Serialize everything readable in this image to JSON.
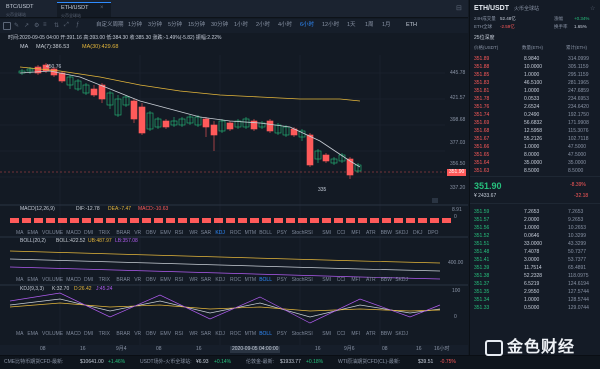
{
  "tabs": [
    {
      "symbol": "BTC/USDT",
      "exchange": "火币全球站"
    },
    {
      "symbol": "ETH/USDT",
      "exchange": "火币全球站"
    }
  ],
  "toolbar": {
    "items": [
      "自定义周期",
      "1分钟",
      "3分钟",
      "5分钟",
      "15分钟",
      "30分钟",
      "1小时",
      "2小时",
      "4小时",
      "6小时",
      "12小时",
      "1天",
      "1周",
      "1月",
      "ETH"
    ],
    "active": "4小时"
  },
  "info": {
    "line1": "时间:2020-09-05 04:00  开:391.16  高:393.00  低:384.30  收:385.30  涨跌:-1.49%(-5.82)  振幅:2.22%",
    "ma_label": "MA",
    "ma7": "MA(7):386.53",
    "ma30": "MA(30):429.68"
  },
  "chart": {
    "y_labels": [
      "445.78",
      "421.57",
      "398.68",
      "377.03",
      "356.50",
      "337.20"
    ],
    "price_tag": "351.90",
    "high_label": "450.76",
    "low_label": "335",
    "macd_label": "MACD(12,26,9)",
    "macd_dif": "DIF:-12.78",
    "macd_dea": "DEA:-7.47",
    "macd_val": "MACD:-10.63",
    "macd_tag": "8.91",
    "macd_tag2": "0",
    "boll_label": "BOLL(20,2)",
    "boll_up": "BOLL:422.52",
    "boll_ub": "UB:487.97",
    "boll_lb": "LB:357.08",
    "boll_tag": "400.00",
    "kdj_label": "KDJ(9,3,3)",
    "kdj_k": "K:32.70",
    "kdj_d": "D:26.42",
    "kdj_j": "J:45.24",
    "kdj_tag": "100",
    "kdj_tag2": "0",
    "indicators": [
      "MA",
      "EMA",
      "VOLUME",
      "MACD",
      "DMI",
      "TRIX",
      "BRAR",
      "VR",
      "OBV",
      "EMV",
      "RSI",
      "WR",
      "SAR",
      "KDJ",
      "ROC",
      "MTM",
      "BOLL",
      "PSY",
      "StochRSI",
      "SMI",
      "CCI",
      "MFI",
      "ATR",
      "BBW",
      "SKDJ",
      "DKJ",
      "DPO"
    ],
    "indicators2": [
      "MA",
      "EMA",
      "VOLUME",
      "MACD",
      "DMI",
      "TRIX",
      "BRAR",
      "VR",
      "OBV",
      "EMV",
      "RSI",
      "WR",
      "SAR",
      "KDJ",
      "ROC",
      "MTM",
      "BOLL",
      "PSY",
      "StochRSI",
      "SMI",
      "CCI",
      "MFI",
      "ATR",
      "BBW",
      "SKDJ"
    ],
    "indicators3": [
      "MA",
      "EMA",
      "VOLUME",
      "MACD",
      "DMI",
      "TRIX",
      "BRAR",
      "VR",
      "OBV",
      "EMV",
      "RSI",
      "WR",
      "SAR",
      "KDJ",
      "ROC",
      "MTM",
      "BOLL",
      "PSY",
      "StochRSI",
      "SMI",
      "CCI",
      "MFI",
      "ATR",
      "BBW",
      "SKDJ"
    ]
  },
  "timebar": {
    "labels": [
      "08",
      "16",
      "9月4",
      "08",
      "16",
      "2020-09-05 04:00:00",
      "16",
      "9月6",
      "08",
      "16"
    ],
    "right": "16小时"
  },
  "right": {
    "title": "ETH/USDT",
    "exchange": "火币全球站",
    "sub1_label": "24H成交量",
    "sub1_val": "52.48亿",
    "sub2_label": "涨幅",
    "sub2_val": "+0.34%",
    "sub3_label": "ETH全球",
    "sub3_val": "-2.59亿",
    "sub4_label": "换手率",
    "sub4_val": "1.65%",
    "depth_label": "25位深度",
    "cols": [
      "价格(USDT)",
      "数量(ETH)",
      "累计(ETH)"
    ],
    "asks": [
      [
        "351.89",
        "8.9840",
        "314.0999"
      ],
      [
        "351.88",
        "10.0000",
        "305.1159"
      ],
      [
        "351.85",
        "1.0000",
        "295.1159"
      ],
      [
        "351.83",
        "46.5100",
        "281.1965"
      ],
      [
        "351.81",
        "1.0000",
        "247.6859"
      ],
      [
        "351.78",
        "0.0533",
        "234.6953"
      ],
      [
        "351.76",
        "2.6524",
        "234.6420"
      ],
      [
        "351.74",
        "0.2490",
        "192.1750"
      ],
      [
        "351.69",
        "56.6832",
        "171.9908"
      ],
      [
        "351.68",
        "12.5958",
        "115.3076"
      ],
      [
        "351.67",
        "55.2126",
        "102.7118"
      ],
      [
        "351.66",
        "1.0000",
        "47.5000"
      ],
      [
        "351.65",
        "8.0000",
        "47.5000"
      ],
      [
        "351.64",
        "35.0000",
        "35.0000"
      ],
      [
        "351.63",
        "8.5000",
        "8.5000"
      ]
    ],
    "last_price": "351.90",
    "last_change": "-8.39%",
    "last_sub": "¥ 2433.67",
    "last_sub2": "-32.18",
    "bids": [
      [
        "351.59",
        "7.2653",
        "7.2653"
      ],
      [
        "351.57",
        "2.0000",
        "9.2653"
      ],
      [
        "351.56",
        "1.0000",
        "10.2653"
      ],
      [
        "351.52",
        "0.0646",
        "10.3299"
      ],
      [
        "351.51",
        "33.0000",
        "43.3299"
      ],
      [
        "351.48",
        "7.4078",
        "50.7377"
      ],
      [
        "351.41",
        "3.0000",
        "53.7377"
      ],
      [
        "351.39",
        "11.7514",
        "65.4891"
      ],
      [
        "351.38",
        "52.2328",
        "118.0975"
      ],
      [
        "351.37",
        "6.5219",
        "124.6194"
      ],
      [
        "351.35",
        "2.9550",
        "127.5744"
      ],
      [
        "351.34",
        "1.0000",
        "128.5744"
      ],
      [
        "351.33",
        "0.5000",
        "129.0744"
      ]
    ]
  },
  "ticker": [
    {
      "name": "CME比特币期货CFD-最新:",
      "price": "$10641.00",
      "chg": "+1.46%",
      "dir": "up"
    },
    {
      "name": "USDT场外-火币全球站:",
      "price": "¥6.93",
      "chg": "+0.14%",
      "dir": "up"
    },
    {
      "name": "伦敦金-最新:",
      "price": "$1933.77",
      "chg": "+0.18%",
      "dir": "up"
    },
    {
      "name": "WTI原油期货CFD(CL)-最新:",
      "price": "$39.51",
      "chg": "-0.75%",
      "dir": "down"
    }
  ],
  "logo": {
    "text": "金色财经"
  },
  "colors": {
    "up": "#26c07d",
    "down": "#ff5a5a",
    "accent": "#2f8cff",
    "ma7": "#c9cfd6",
    "ma30": "#e5b73b"
  }
}
